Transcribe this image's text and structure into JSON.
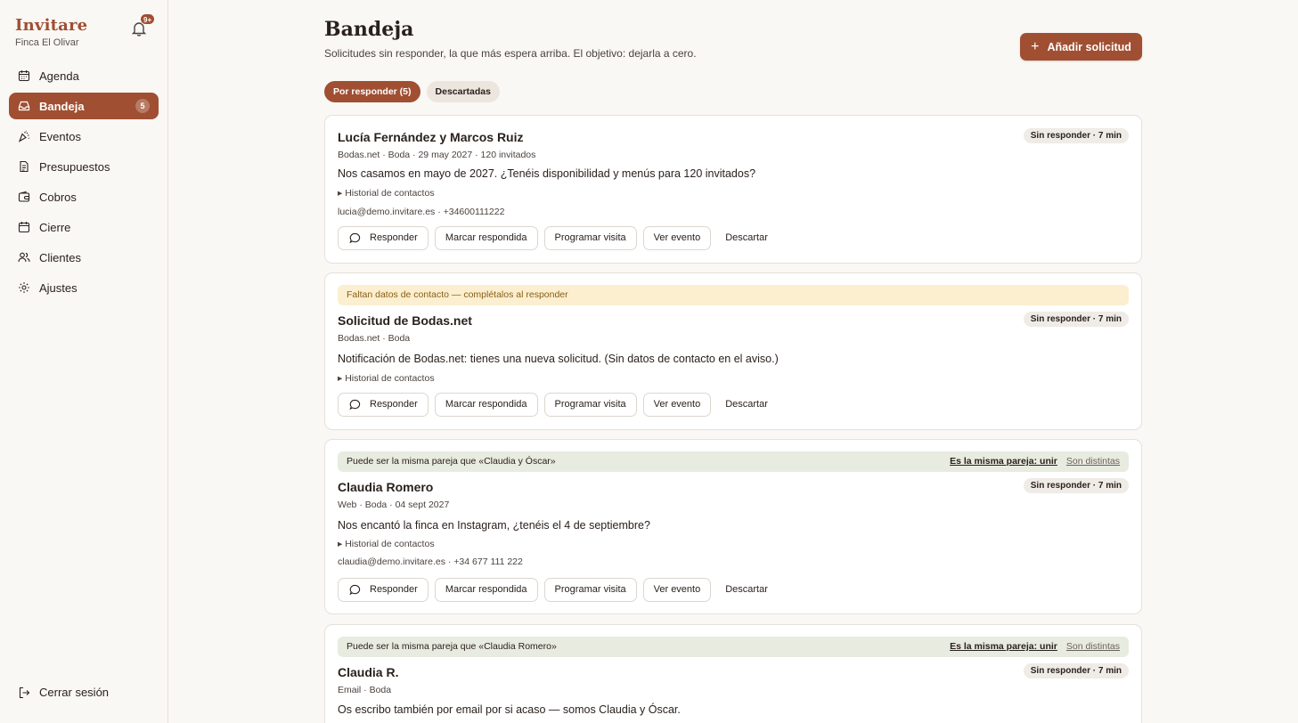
{
  "brand": {
    "name": "Invitare",
    "venue": "Finca El Olivar"
  },
  "notifications": {
    "count": "9+",
    "icon": "bell-icon"
  },
  "nav": [
    {
      "label": "Agenda",
      "icon": "calendar-icon",
      "active": false
    },
    {
      "label": "Bandeja",
      "icon": "inbox-icon",
      "active": true,
      "badge": "5"
    },
    {
      "label": "Eventos",
      "icon": "party-icon",
      "active": false
    },
    {
      "label": "Presupuestos",
      "icon": "document-icon",
      "active": false
    },
    {
      "label": "Cobros",
      "icon": "wallet-icon",
      "active": false
    },
    {
      "label": "Cierre",
      "icon": "calendar-check-icon",
      "active": false
    },
    {
      "label": "Clientes",
      "icon": "users-icon",
      "active": false
    },
    {
      "label": "Ajustes",
      "icon": "gear-icon",
      "active": false
    }
  ],
  "logout": {
    "label": "Cerrar sesión",
    "icon": "logout-icon"
  },
  "header": {
    "title": "Bandeja",
    "subtitle": "Solicitudes sin responder, la que más espera arriba. El objetivo: dejarla a cero.",
    "add_button": "Añadir solicitud"
  },
  "tabs": [
    {
      "label": "Por responder (5)",
      "active": true
    },
    {
      "label": "Descartadas",
      "active": false
    }
  ],
  "actions": {
    "reply": "Responder",
    "mark": "Marcar respondida",
    "schedule": "Programar visita",
    "view": "Ver evento",
    "discard": "Descartar"
  },
  "requests": [
    {
      "title": "Lucía Fernández y Marcos Ruiz",
      "status": "Sin responder · 7 min",
      "meta": "Bodas.net · Boda · 29 may 2027 · 120 invitados",
      "message": "Nos casamos en mayo de 2027. ¿Tenéis disponibilidad y menús para 120 invitados?",
      "history": "▸ Historial de contactos",
      "contact": "lucia@demo.invitare.es · +34600111222"
    },
    {
      "notice": "Faltan datos de contacto — complétalos al responder",
      "title": "Solicitud de Bodas.net",
      "status": "Sin responder · 7 min",
      "meta": "Bodas.net · Boda",
      "message": "Notificación de Bodas.net: tienes una nueva solicitud. (Sin datos de contacto en el aviso.)",
      "history": "▸ Historial de contactos"
    },
    {
      "duplicate": "Puede ser la misma pareja que «Claudia y Óscar»",
      "dup_join": "Es la misma pareja: unir",
      "dup_separate": "Son distintas",
      "title": "Claudia Romero",
      "status": "Sin responder · 7 min",
      "meta": "Web · Boda · 04 sept 2027",
      "message": "Nos encantó la finca en Instagram, ¿tenéis el 4 de septiembre?",
      "history": "▸ Historial de contactos",
      "contact": "claudia@demo.invitare.es · +34 677 111 222"
    },
    {
      "duplicate": "Puede ser la misma pareja que «Claudia Romero»",
      "dup_join": "Es la misma pareja: unir",
      "dup_separate": "Son distintas",
      "title": "Claudia R.",
      "status": "Sin responder · 7 min",
      "meta": "Email · Boda",
      "message": "Os escribo también por email por si acaso — somos Claudia y Óscar."
    }
  ],
  "colors": {
    "accent": "#a04f32",
    "background": "#faf8f5",
    "warn": "#fbefd0",
    "duplicate": "#e8ebe0"
  }
}
